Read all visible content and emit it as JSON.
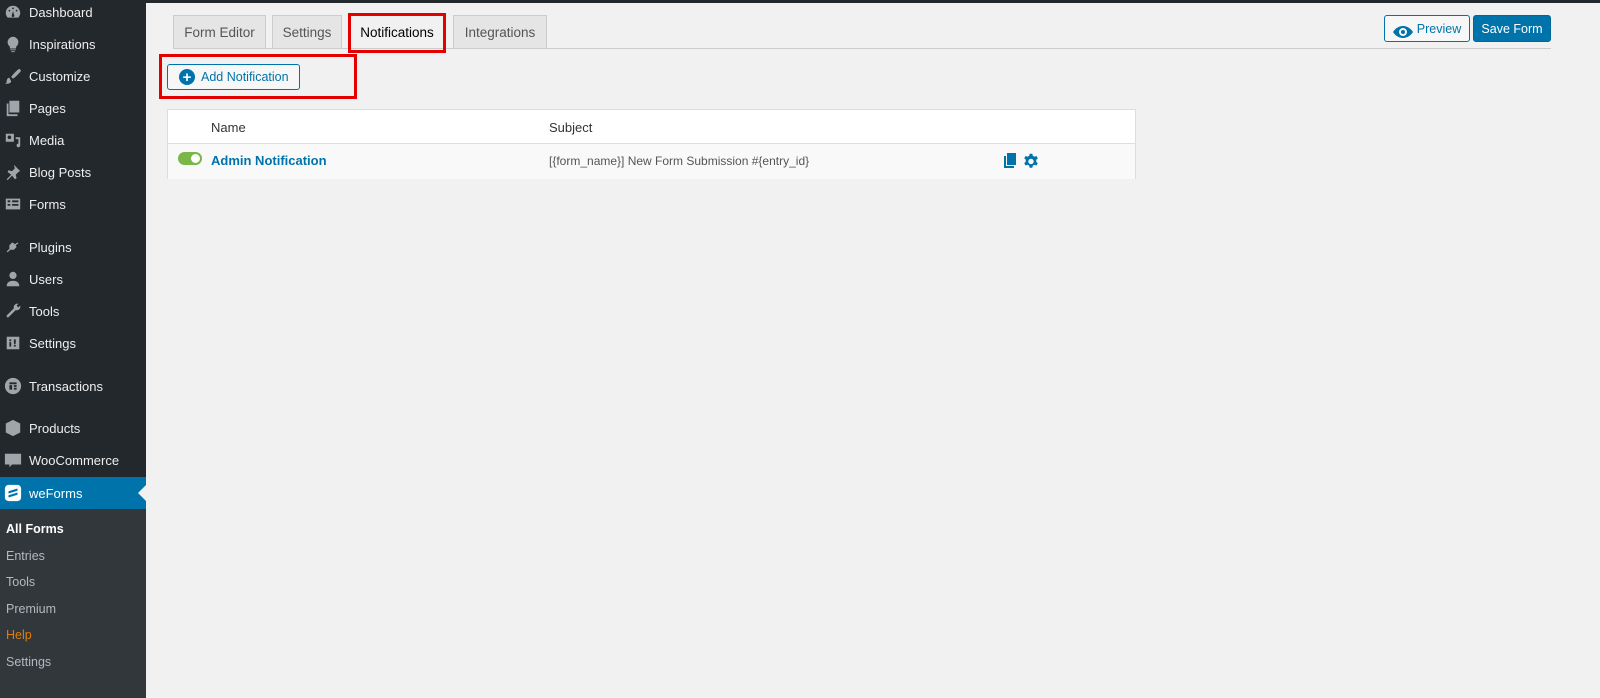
{
  "sidebar": {
    "items": [
      {
        "label": "Dashboard",
        "icon": "dashboard-icon"
      },
      {
        "label": "Inspirations",
        "icon": "lightbulb-icon"
      },
      {
        "label": "Customize",
        "icon": "paintbrush-icon"
      },
      {
        "label": "Pages",
        "icon": "pages-icon"
      },
      {
        "label": "Media",
        "icon": "media-icon"
      },
      {
        "label": "Blog Posts",
        "icon": "pushpin-icon"
      },
      {
        "label": "Forms",
        "icon": "forms-icon"
      },
      {
        "label": "Plugins",
        "icon": "plugin-icon"
      },
      {
        "label": "Users",
        "icon": "user-icon"
      },
      {
        "label": "Tools",
        "icon": "wrench-icon"
      },
      {
        "label": "Settings",
        "icon": "settings-icon"
      },
      {
        "label": "Transactions",
        "icon": "transactions-icon"
      },
      {
        "label": "Products",
        "icon": "box-icon"
      },
      {
        "label": "WooCommerce",
        "icon": "woocommerce-icon"
      },
      {
        "label": "weForms",
        "icon": "weforms-icon"
      }
    ],
    "submenu": [
      {
        "label": "All Forms"
      },
      {
        "label": "Entries"
      },
      {
        "label": "Tools"
      },
      {
        "label": "Premium"
      },
      {
        "label": "Help"
      },
      {
        "label": "Settings"
      }
    ]
  },
  "tabs": [
    {
      "label": "Form Editor"
    },
    {
      "label": "Settings"
    },
    {
      "label": "Notifications"
    },
    {
      "label": "Integrations"
    }
  ],
  "active_tab": "Notifications",
  "toolbar": {
    "preview_label": "Preview",
    "save_label": "Save Form"
  },
  "add_notification_label": "Add Notification",
  "table": {
    "headers": {
      "name": "Name",
      "subject": "Subject"
    },
    "rows": [
      {
        "enabled": true,
        "name": "Admin Notification",
        "subject": "[{form_name}] New Form Submission #{entry_id}"
      }
    ]
  },
  "colors": {
    "accent": "#0073aa",
    "sidebar_bg": "#23282d",
    "highlight": "#e50000",
    "toggle_on": "#7ab648",
    "help_link": "#e27c00"
  }
}
